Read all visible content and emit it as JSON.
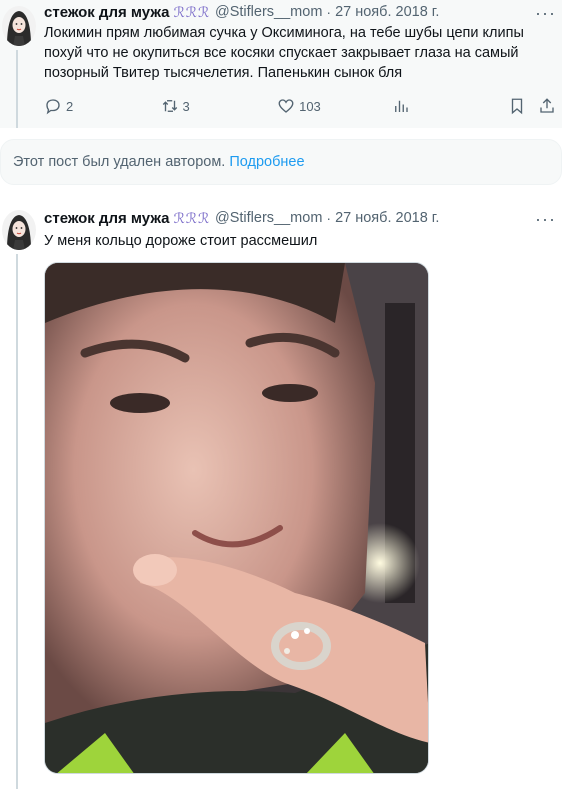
{
  "tweets": [
    {
      "author_name": "стежок для мужа",
      "author_emoji": "ℛℛℛ",
      "handle": "@Stiflers__mom",
      "separator": "·",
      "date": "27 нояб. 2018 г.",
      "text": "Локимин прям любимая сучка у Оксиминога, на тебе шубы цепи клипы похуй что не окупиться все косяки спускает закрывает глаза на самый позорный Твитер тысячелетия. Папенькин сынок бля",
      "reply_count": "2",
      "retweet_count": "3",
      "like_count": "103"
    },
    {
      "author_name": "стежок для мужа",
      "author_emoji": "ℛℛℛ",
      "handle": "@Stiflers__mom",
      "separator": "·",
      "date": "27 нояб. 2018 г.",
      "text": "У меня кольцо дороже стоит рассмешил"
    }
  ],
  "deleted_notice": {
    "text": "Этот пост был удален автором.",
    "link": "Подробнее"
  },
  "more_label": "···",
  "icons": {
    "reply": "reply-icon",
    "retweet": "retweet-icon",
    "like": "like-icon",
    "views": "views-icon",
    "bookmark": "bookmark-icon",
    "share": "share-icon"
  },
  "colors": {
    "link": "#1d9bf0",
    "secondary_text": "#536471",
    "primary_text": "#0f1419",
    "highlight_bg": "#f7f9f9"
  }
}
